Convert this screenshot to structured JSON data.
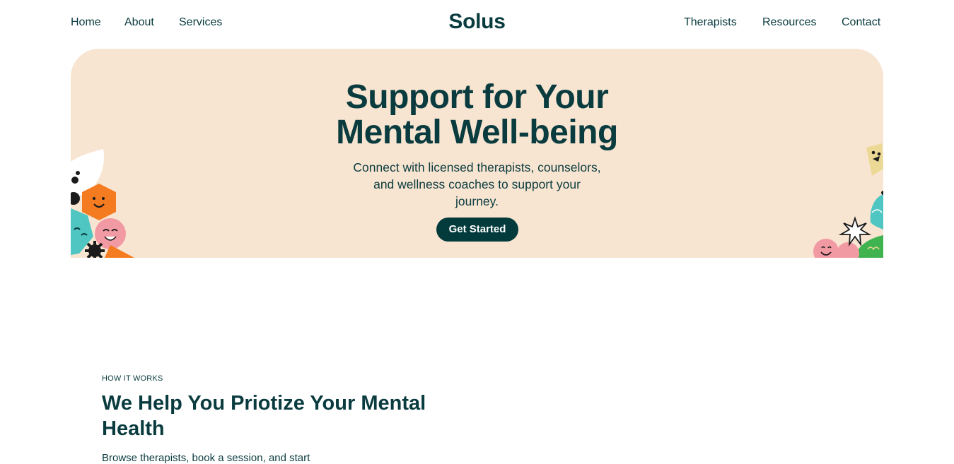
{
  "nav": {
    "left": [
      "Home",
      "About",
      "Services"
    ],
    "brand": "Solus",
    "right": [
      "Therapists",
      "Resources",
      "Contact"
    ]
  },
  "hero": {
    "title_line1": "Support for Your",
    "title_line2": "Mental Well-being",
    "subtitle_line1": "Connect with licensed therapists, counselors,",
    "subtitle_line2": "and wellness coaches to support your",
    "subtitle_line3": "journey.",
    "cta_label": "Get Started"
  },
  "how_it_works": {
    "eyebrow": "HOW IT WORKS",
    "title": "We Help You Priotize Your Mental Health",
    "description": "Browse therapists, book a session, and start"
  },
  "colors": {
    "primary": "#0a3b3f",
    "hero_bg": "#f8e5d1",
    "button_bg": "#033b3c",
    "accent_orange": "#f47b20",
    "accent_pink": "#f29aa3",
    "accent_teal": "#4fc6c1",
    "accent_green": "#3fb34f",
    "accent_yellow": "#ecd995"
  }
}
